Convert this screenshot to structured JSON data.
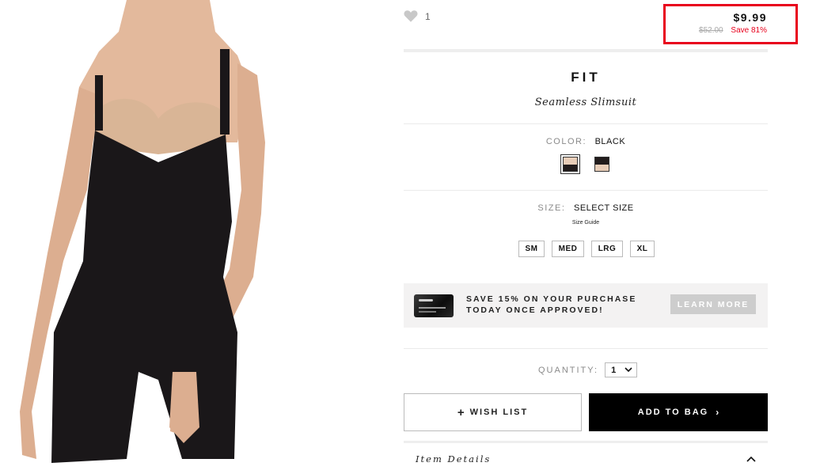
{
  "favorite": {
    "count": "1",
    "icon": "heart-icon"
  },
  "price": {
    "current": "$9.99",
    "original": "$52.00",
    "savings": "Save 81%",
    "highlight_color": "#e8001c"
  },
  "product": {
    "brand": "FIT",
    "name": "Seamless Slimsuit"
  },
  "color": {
    "label": "COLOR:",
    "selected": "BLACK",
    "swatches": [
      {
        "name": "nude/black",
        "top": "#e8cdb8",
        "bottom": "#221c1c",
        "selected": true
      },
      {
        "name": "black/nude",
        "top": "#221c1c",
        "bottom": "#e8cdb8",
        "selected": false
      }
    ]
  },
  "size": {
    "label": "SIZE:",
    "selected": "SELECT SIZE",
    "guide": "Size Guide",
    "options": [
      "SM",
      "MED",
      "LRG",
      "XL"
    ]
  },
  "promo": {
    "line1": "SAVE 15% ON YOUR PURCHASE",
    "line2": "TODAY ONCE APPROVED!",
    "button": "LEARN MORE"
  },
  "quantity": {
    "label": "QUANTITY:",
    "value": "1"
  },
  "actions": {
    "wishlist": "WISH LIST",
    "add_to_bag": "ADD TO BAG"
  },
  "details": {
    "label": "Item Details"
  }
}
